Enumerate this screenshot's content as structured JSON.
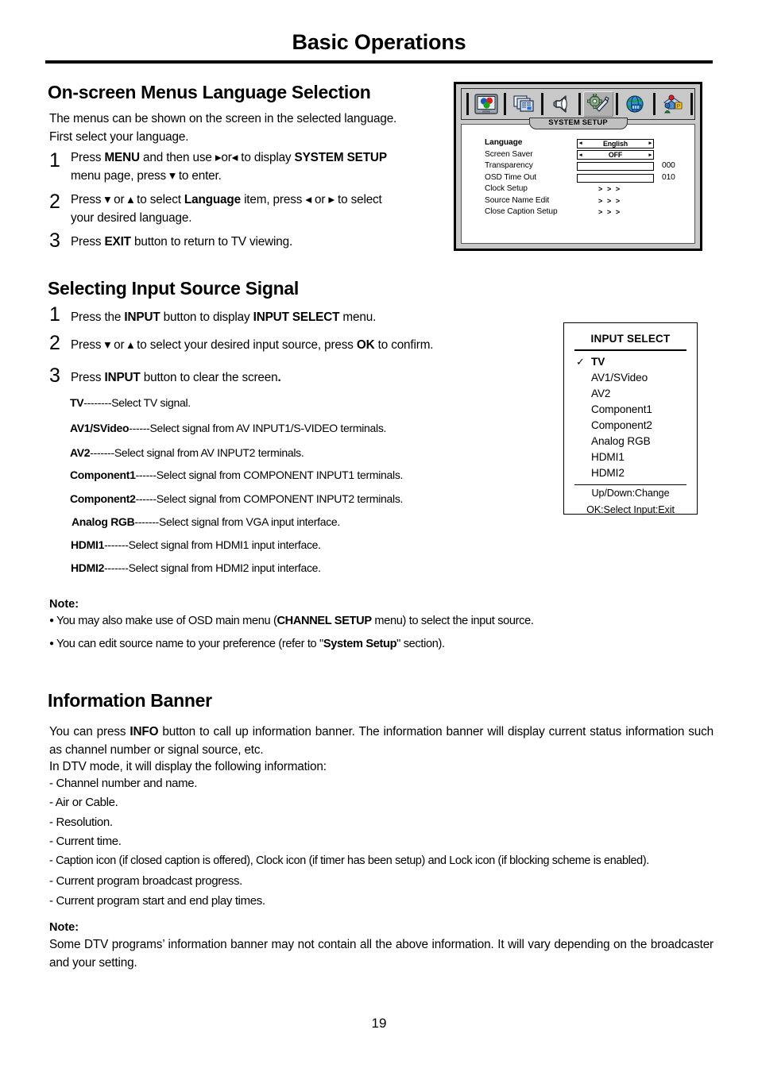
{
  "document": {
    "page_title": "Basic Operations",
    "page_number": "19"
  },
  "section_language": {
    "heading": "On-screen Menus Language Selection",
    "intro_line1": "The menus can be shown on the screen in the selected language.",
    "intro_line2": "First select your language.",
    "steps": [
      {
        "number": "1",
        "line1_a": "Press",
        "line1_menu": "MENU",
        "line1_b": "and then use",
        "arrow_right": "▸",
        "line1_or": "or",
        "arrow_left": "◂",
        "line1_c": "to display",
        "line1_target": "SYSTEM SETUP",
        "line2_a": "menu page, press",
        "arrow_down": "▾",
        "line2_b": "to enter."
      },
      {
        "number": "2",
        "line1_a": "Press",
        "arrow_down": "▾",
        "line1_or1": "or",
        "arrow_up": "▴",
        "line1_b": "to select",
        "line1_item": "Language",
        "line1_c": "item, press",
        "arrow_left": "◂",
        "line1_or2": "or",
        "arrow_right": "▸",
        "line1_d": "to select",
        "line2": "your desired language."
      },
      {
        "number": "3",
        "line1_a": "Press",
        "line1_key": "EXIT",
        "line1_b": "button to return to TV viewing."
      }
    ]
  },
  "osd_system_setup": {
    "tab_title": "SYSTEM SETUP",
    "icons": [
      "picture-settings-icon",
      "channel-settings-icon",
      "audio-speaker-icon",
      "system-setup-gear-icon",
      "network-globe-icon",
      "parental-lock-icon"
    ],
    "selected_icon_index": 3,
    "rows": [
      {
        "label": "Language",
        "bold": true,
        "type": "select",
        "value": "English"
      },
      {
        "label": "Screen Saver",
        "bold": false,
        "type": "select",
        "value": "OFF"
      },
      {
        "label": "Transparency",
        "bold": false,
        "type": "slider",
        "fill_percent": 0,
        "value": "000"
      },
      {
        "label": "OSD Time Out",
        "bold": false,
        "type": "slider",
        "fill_percent": 12,
        "value": "010"
      },
      {
        "label": "Clock Setup",
        "bold": false,
        "type": "submenu",
        "value": "> > >"
      },
      {
        "label": "Source Name Edit",
        "bold": false,
        "type": "submenu",
        "value": "> > >"
      },
      {
        "label": "Close Caption Setup",
        "bold": false,
        "type": "submenu",
        "value": "> > >"
      }
    ],
    "left_arrow": "◂",
    "right_arrow": "▸"
  },
  "section_input": {
    "heading": "Selecting Input Source Signal",
    "steps": [
      {
        "number": "1",
        "a": "Press the",
        "key1": "INPUT",
        "b": "button to display",
        "key2": "INPUT SELECT",
        "c": "menu."
      },
      {
        "number": "2",
        "a": "Press",
        "arrow_down": "▾",
        "or": "or",
        "arrow_up": "▴",
        "b": "to select your desired input source, press",
        "key1": "OK",
        "c": "to confirm."
      },
      {
        "number": "3",
        "a": "Press",
        "key1": "INPUT",
        "b": "button to clear the screen",
        "c": "."
      }
    ],
    "source_descriptions": [
      {
        "name": "TV",
        "dashes": "--------",
        "desc": "Select TV signal."
      },
      {
        "name": "AV1/SVideo",
        "dashes": "------",
        "desc": "Select signal from AV INPUT1/S-VIDEO terminals."
      },
      {
        "name": "AV2",
        "dashes": "-------",
        "desc": "Select signal from AV INPUT2  terminals."
      },
      {
        "name": "Component1",
        "dashes": "------",
        "desc": "Select signal from COMPONENT INPUT1 terminals."
      },
      {
        "name": "Component2",
        "dashes": "------",
        "desc": "Select signal from COMPONENT INPUT2 terminals."
      },
      {
        "name": "Analog RGB",
        "dashes": "-------",
        "desc": "Select signal from VGA input interface."
      },
      {
        "name": "HDMI1",
        "dashes": "-------",
        "desc": "Select signal from HDMI1 input interface."
      },
      {
        "name": "HDMI2",
        "dashes": "-------",
        "desc": "Select signal from HDMI2 input interface."
      }
    ],
    "note_heading": "Note:",
    "notes": [
      {
        "a": "You may also make use of OSD main menu (",
        "bold": "CHANNEL SETUP",
        "b": " menu) to select the input source."
      },
      {
        "a": "You can edit source name to your preference (refer to \"",
        "bold": "System Setup",
        "b": "\" section)."
      }
    ]
  },
  "input_select_panel": {
    "title": "INPUT SELECT",
    "check_glyph": "✓",
    "items": [
      {
        "label": "TV",
        "selected": true
      },
      {
        "label": "AV1/SVideo",
        "selected": false
      },
      {
        "label": "AV2",
        "selected": false
      },
      {
        "label": "Component1",
        "selected": false
      },
      {
        "label": "Component2",
        "selected": false
      },
      {
        "label": "Analog RGB",
        "selected": false
      },
      {
        "label": "HDMI1",
        "selected": false
      },
      {
        "label": "HDMI2",
        "selected": false
      }
    ],
    "hint_line1": "Up/Down:Change",
    "hint_line2": "OK:Select  Input:Exit"
  },
  "section_banner": {
    "heading": "Information Banner",
    "para1_a": "You can press",
    "para1_key": "INFO",
    "para1_b": "button to call up information banner. The information banner will display current status information such as channel number or signal source, etc.",
    "para2": "In DTV mode, it will display the following information:",
    "items": [
      "- Channel number and name.",
      "- Air or Cable.",
      "- Resolution.",
      "- Current time.",
      "- Caption icon (if closed caption is offered), Clock icon (if timer has been setup) and Lock icon (if blocking scheme is enabled).",
      "- Current program broadcast progress.",
      "- Current program start and end play times."
    ],
    "note_heading": "Note:",
    "note_body": "Some DTV programs’ information banner may not contain all the above information. It will vary depending on the broadcaster and your setting."
  }
}
